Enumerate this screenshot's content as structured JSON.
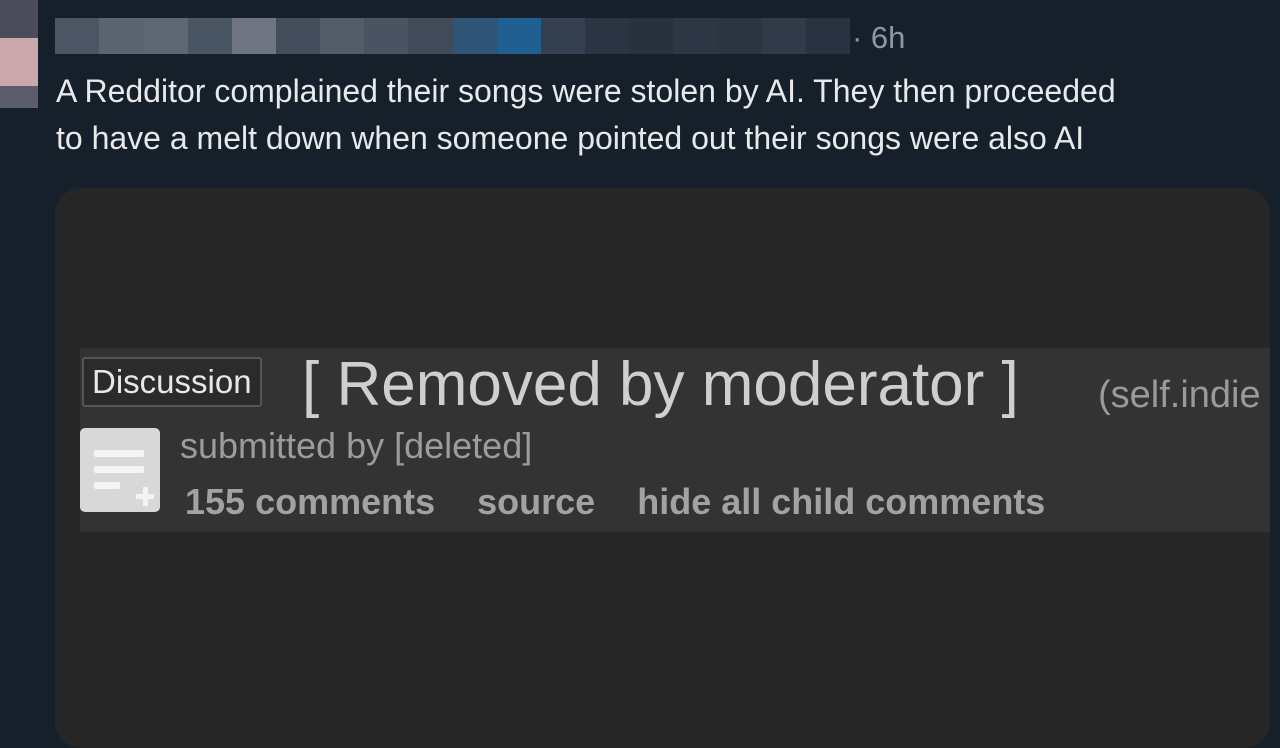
{
  "tweet": {
    "timestamp": "· 6h",
    "text_lines": [
      "A Redditor complained their songs were stolen by AI. They then proceeded",
      "to have a melt down when someone pointed out their songs were also AI"
    ]
  },
  "embedded_post": {
    "flair": "Discussion",
    "title": "[ Removed by moderator ]",
    "subreddit": "(self.indie",
    "submitted_by": "submitted by [deleted]",
    "actions": [
      "155 comments",
      "source",
      "hide all child comments"
    ]
  },
  "colors": {
    "page_background": "#16202b",
    "card_background": "#262626",
    "strip_background": "#333333",
    "muted_text": "#8b98a5"
  },
  "icons": {
    "avatar": "pixelated-avatar",
    "thumbnail": "self-post-text-icon"
  }
}
